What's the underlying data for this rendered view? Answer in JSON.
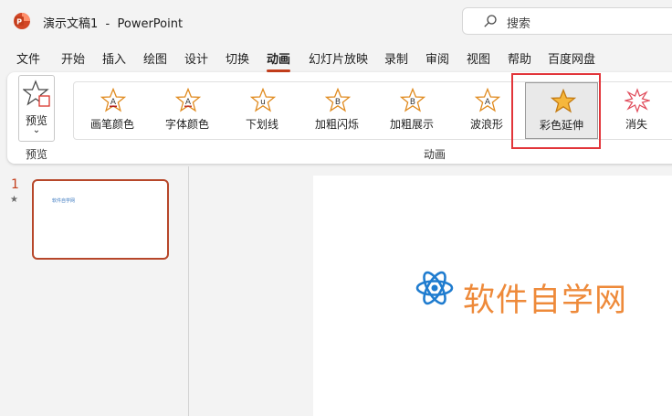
{
  "titlebar": {
    "doc_title": "演示文稿1  -  PowerPoint",
    "search_placeholder": "搜索"
  },
  "menu_tabs": [
    {
      "label": "文件"
    },
    {
      "label": "开始"
    },
    {
      "label": "插入"
    },
    {
      "label": "绘图"
    },
    {
      "label": "设计"
    },
    {
      "label": "切换"
    },
    {
      "label": "动画",
      "active": true
    },
    {
      "label": "幻灯片放映"
    },
    {
      "label": "录制"
    },
    {
      "label": "审阅"
    },
    {
      "label": "视图"
    },
    {
      "label": "帮助"
    },
    {
      "label": "百度网盘"
    }
  ],
  "ribbon": {
    "preview_label": "预览",
    "preview_group_label": "预览",
    "animation_group_label": "动画",
    "animations": [
      {
        "label": "画笔颜色",
        "icon": "star-pen-color-icon",
        "glyph": "A"
      },
      {
        "label": "字体颜色",
        "icon": "star-font-color-icon",
        "glyph": "A"
      },
      {
        "label": "下划线",
        "icon": "star-underline-icon",
        "glyph": "u"
      },
      {
        "label": "加粗闪烁",
        "icon": "star-bold-flash-icon",
        "glyph": "B"
      },
      {
        "label": "加粗展示",
        "icon": "star-bold-reveal-icon",
        "glyph": "B"
      },
      {
        "label": "波浪形",
        "icon": "star-wave-icon",
        "glyph": "A"
      },
      {
        "label": "彩色延伸",
        "icon": "star-color-pulse-icon",
        "glyph": "",
        "selected": true
      },
      {
        "label": "消失",
        "icon": "star-disappear-icon",
        "glyph": ""
      }
    ]
  },
  "thumbnail": {
    "slide_number": "1",
    "star_marker": "★",
    "mini_text": "软件自学网"
  },
  "slide": {
    "logo_text": "软件自学网"
  },
  "colors": {
    "accent": "#c43e1c",
    "highlight_box": "#e2353a",
    "logo_blue": "#1f7ccf",
    "logo_orange": "#ee8a3a"
  }
}
